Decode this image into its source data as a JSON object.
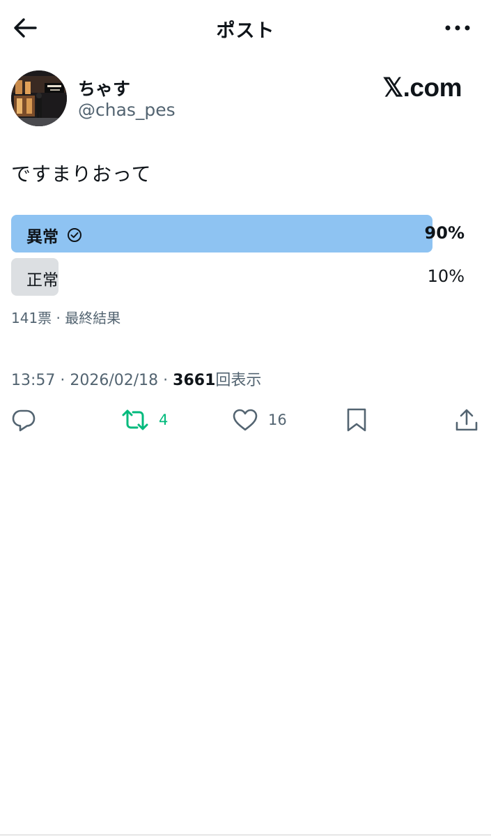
{
  "header": {
    "title": "ポスト",
    "back_icon": "arrow-left-icon",
    "more_icon": "more-dots-icon"
  },
  "author": {
    "display_name": "ちゃす",
    "handle": "@chas_pes"
  },
  "brand": "𝕏.com",
  "post": {
    "text": "ですまりおって"
  },
  "poll": {
    "options": [
      {
        "label": "異常",
        "percent": "90%",
        "share": 0.9,
        "winner": true,
        "icon": "check-circle-icon"
      },
      {
        "label": "正常",
        "percent": "10%",
        "share": 0.1,
        "winner": false
      }
    ],
    "summary": "141票 · 最終結果"
  },
  "meta": {
    "timestamp": "13:57 · 2026/02/18 · ",
    "views_count": "3661",
    "views_label": "回表示"
  },
  "actions": {
    "reply": {
      "icon": "reply-icon",
      "count": ""
    },
    "retweet": {
      "icon": "retweet-icon",
      "count": "4",
      "color": "#00ba7c"
    },
    "like": {
      "icon": "heart-icon",
      "count": "16"
    },
    "bookmark": {
      "icon": "bookmark-icon"
    },
    "share": {
      "icon": "share-icon"
    }
  },
  "colors": {
    "accent_fill": "#8ec3f2",
    "secondary_fill": "#dcdfe2",
    "muted_text": "#536471"
  }
}
